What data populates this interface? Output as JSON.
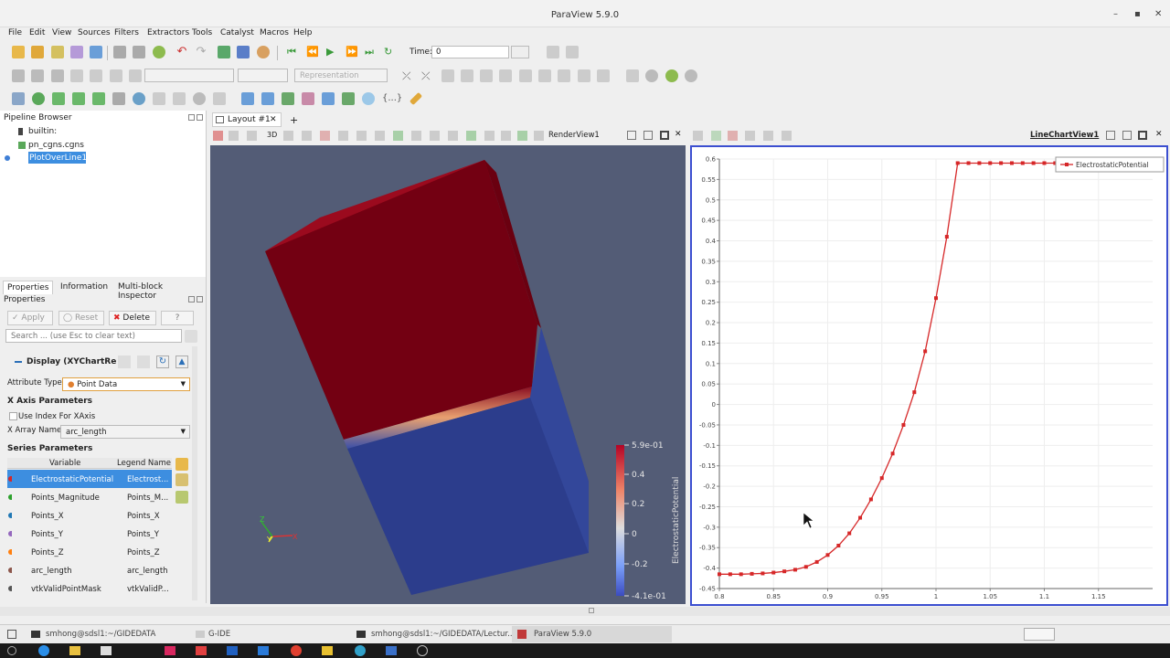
{
  "app": {
    "window_title": "ParaView 5.9.0",
    "menu": [
      "File",
      "Edit",
      "View",
      "Sources",
      "Filters",
      "Extractors",
      "Tools",
      "Catalyst",
      "Macros",
      "Help"
    ],
    "time_label": "Time:",
    "time_value": "0",
    "representation_placeholder": "Representation"
  },
  "pipeline": {
    "header": "Pipeline Browser",
    "items": [
      "builtin:",
      "pn_cgns.cgns",
      "PlotOverLine1"
    ]
  },
  "properties": {
    "tabs": [
      "Properties",
      "Information",
      "Multi-block Inspector"
    ],
    "header": "Properties",
    "apply_label": "Apply",
    "reset_label": "Reset",
    "delete_label": "Delete",
    "help_label": "?",
    "search_placeholder": "Search ... (use Esc to clear text)",
    "display_section": "Display (XYChartRe",
    "attribute_type_label": "Attribute Type",
    "attribute_type_value": "Point Data",
    "x_axis_section": "X Axis Parameters",
    "use_index_label": "Use Index For XAxis",
    "x_array_label": "X Array Name",
    "x_array_value": "arc_length",
    "series_section": "Series Parameters",
    "series_headers": [
      "Variable",
      "Legend Name"
    ],
    "series_rows": [
      {
        "variable": "ElectrostaticPotential",
        "legend": "Electrost...",
        "color": "#d62728"
      },
      {
        "variable": "Points_Magnitude",
        "legend": "Points_M...",
        "color": "#2ca02c"
      },
      {
        "variable": "Points_X",
        "legend": "Points_X",
        "color": "#1f77b4"
      },
      {
        "variable": "Points_Y",
        "legend": "Points_Y",
        "color": "#9467bd"
      },
      {
        "variable": "Points_Z",
        "legend": "Points_Z",
        "color": "#ff7f0e"
      },
      {
        "variable": "arc_length",
        "legend": "arc_length",
        "color": "#8c564b"
      },
      {
        "variable": "vtkValidPointMask",
        "legend": "vtkValidP...",
        "color": "#555555"
      }
    ]
  },
  "layout": {
    "tab_label": "Layout #1",
    "render_view_label": "RenderView1",
    "chart_view_label": "LineChartView1"
  },
  "colorbar": {
    "title": "ElectrostaticPotential",
    "ticks": [
      "5.9e-01",
      "0.4",
      "0.2",
      "0",
      "-0.2",
      "-4.1e-01"
    ]
  },
  "chart_data": {
    "type": "line",
    "series": [
      {
        "name": "ElectrostaticPotential",
        "color": "#d62728",
        "x": [
          0.8,
          0.81,
          0.82,
          0.83,
          0.84,
          0.85,
          0.86,
          0.87,
          0.88,
          0.89,
          0.9,
          0.91,
          0.92,
          0.93,
          0.94,
          0.95,
          0.96,
          0.97,
          0.98,
          0.99,
          1.0,
          1.01,
          1.02,
          1.03,
          1.04,
          1.05,
          1.06,
          1.07,
          1.08,
          1.09,
          1.1,
          1.11
        ],
        "y": [
          -0.415,
          -0.415,
          -0.415,
          -0.414,
          -0.413,
          -0.411,
          -0.408,
          -0.404,
          -0.397,
          -0.385,
          -0.368,
          -0.345,
          -0.315,
          -0.277,
          -0.232,
          -0.18,
          -0.12,
          -0.05,
          0.03,
          0.13,
          0.26,
          0.41,
          0.59,
          0.59,
          0.59,
          0.59,
          0.59,
          0.59,
          0.59,
          0.59,
          0.59,
          0.59
        ]
      }
    ],
    "xlim": [
      0.8,
      1.2
    ],
    "ylim": [
      -0.45,
      0.6
    ],
    "x_ticks": [
      "0.8",
      "0.85",
      "0.9",
      "0.95",
      "1",
      "1.05",
      "1.1",
      "1.15"
    ],
    "y_ticks": [
      "0.6",
      "0.55",
      "0.5",
      "0.45",
      "0.4",
      "0.35",
      "0.3",
      "0.25",
      "0.2",
      "0.15",
      "0.1",
      "0.05",
      "0",
      "-0.05",
      "-0.1",
      "-0.15",
      "-0.2",
      "-0.25",
      "-0.3",
      "-0.35",
      "-0.4",
      "-0.45"
    ],
    "grid": true,
    "legend_position": "top-right"
  },
  "taskbar": {
    "items": [
      "smhong@sdsl1:~/GIDEDATA",
      "G-IDE",
      "smhong@sdsl1:~/GIDEDATA/Lectur...",
      "ParaView 5.9.0"
    ]
  }
}
